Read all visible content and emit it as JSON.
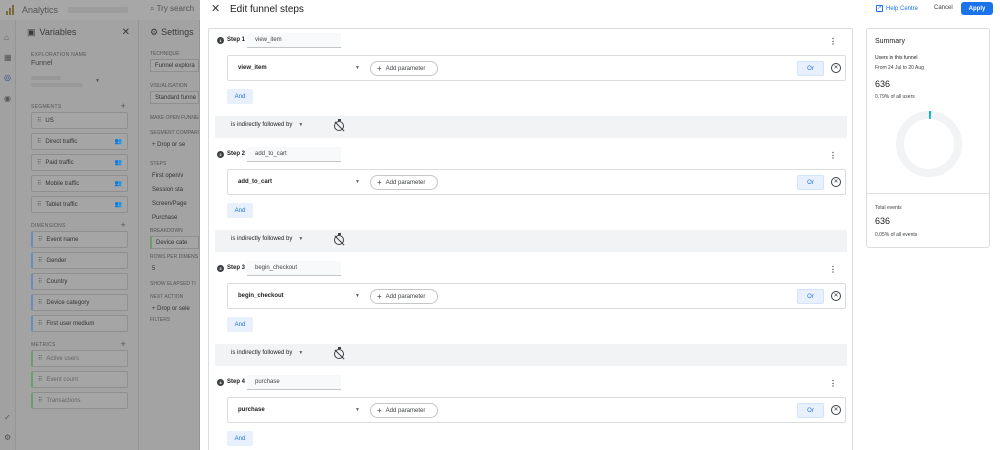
{
  "app": {
    "title": "Analytics",
    "search_placeholder": "Try search"
  },
  "variables": {
    "title": "Variables",
    "exploration_label": "EXPLORATION NAME",
    "exploration_name": "Funnel",
    "segments_label": "SEGMENTS",
    "segments": [
      "US",
      "Direct traffic",
      "Paid traffic",
      "Mobile traffic",
      "Tablet traffic"
    ],
    "dimensions_label": "DIMENSIONS",
    "dimensions": [
      "Event name",
      "Gender",
      "Country",
      "Device category",
      "First user medium"
    ],
    "metrics_label": "METRICS",
    "metrics": [
      "Active users",
      "Event count",
      "Transactions"
    ]
  },
  "settings": {
    "title": "Settings",
    "technique_label": "TECHNIQUE",
    "technique_value": "Funnel explora",
    "visualisation_label": "VISUALISATION",
    "visualisation_value": "Standard funne",
    "open_funnel_label": "MAKE OPEN FUNNEL",
    "segment_comparisons_label": "SEGMENT COMPARI",
    "drop_text": "+ Drop or se",
    "steps_label": "STEPS",
    "steps": [
      "First open/v",
      "Session sta",
      "Screen/Page",
      "Purchase"
    ],
    "breakdown_label": "BREAKDOWN",
    "breakdown_value": "Device cate",
    "rows_label": "ROWS PER DIMENS",
    "rows_value": "5",
    "elapsed_label": "SHOW ELAPSED TI",
    "next_action_label": "NEXT ACTION",
    "next_action_value": "+ Drop or sele",
    "filters_label": "FILTERS"
  },
  "modal": {
    "title": "Edit funnel steps",
    "help_label": "Help Centre",
    "cancel_label": "Cancel",
    "apply_label": "Apply",
    "add_parameter_label": "Add parameter",
    "or_label": "Or",
    "and_label": "And",
    "sequence_label": "is indirectly followed by",
    "steps": [
      {
        "number": "1",
        "label": "Step 1",
        "name": "view_item",
        "event": "view_item"
      },
      {
        "number": "2",
        "label": "Step 2",
        "name": "add_to_cart",
        "event": "add_to_cart"
      },
      {
        "number": "3",
        "label": "Step 3",
        "name": "begin_checkout",
        "event": "begin_checkout"
      },
      {
        "number": "4",
        "label": "Step 4",
        "name": "purchase",
        "event": "purchase"
      }
    ]
  },
  "summary": {
    "title": "Summary",
    "users_label": "Users in this funnel",
    "date_range": "From 24 Jul to 20 Aug",
    "users_value": "636",
    "users_pct": "0.79% of all users",
    "users_fraction": 0.0079,
    "total_events_label": "Total events",
    "total_events_value": "636",
    "total_events_pct": "0.05% of all events"
  },
  "colors": {
    "accent": "#1a73e8",
    "accent_light": "#e8f0fe",
    "donut_track": "#f1f3f4",
    "donut_fill": "#12b5cb"
  }
}
